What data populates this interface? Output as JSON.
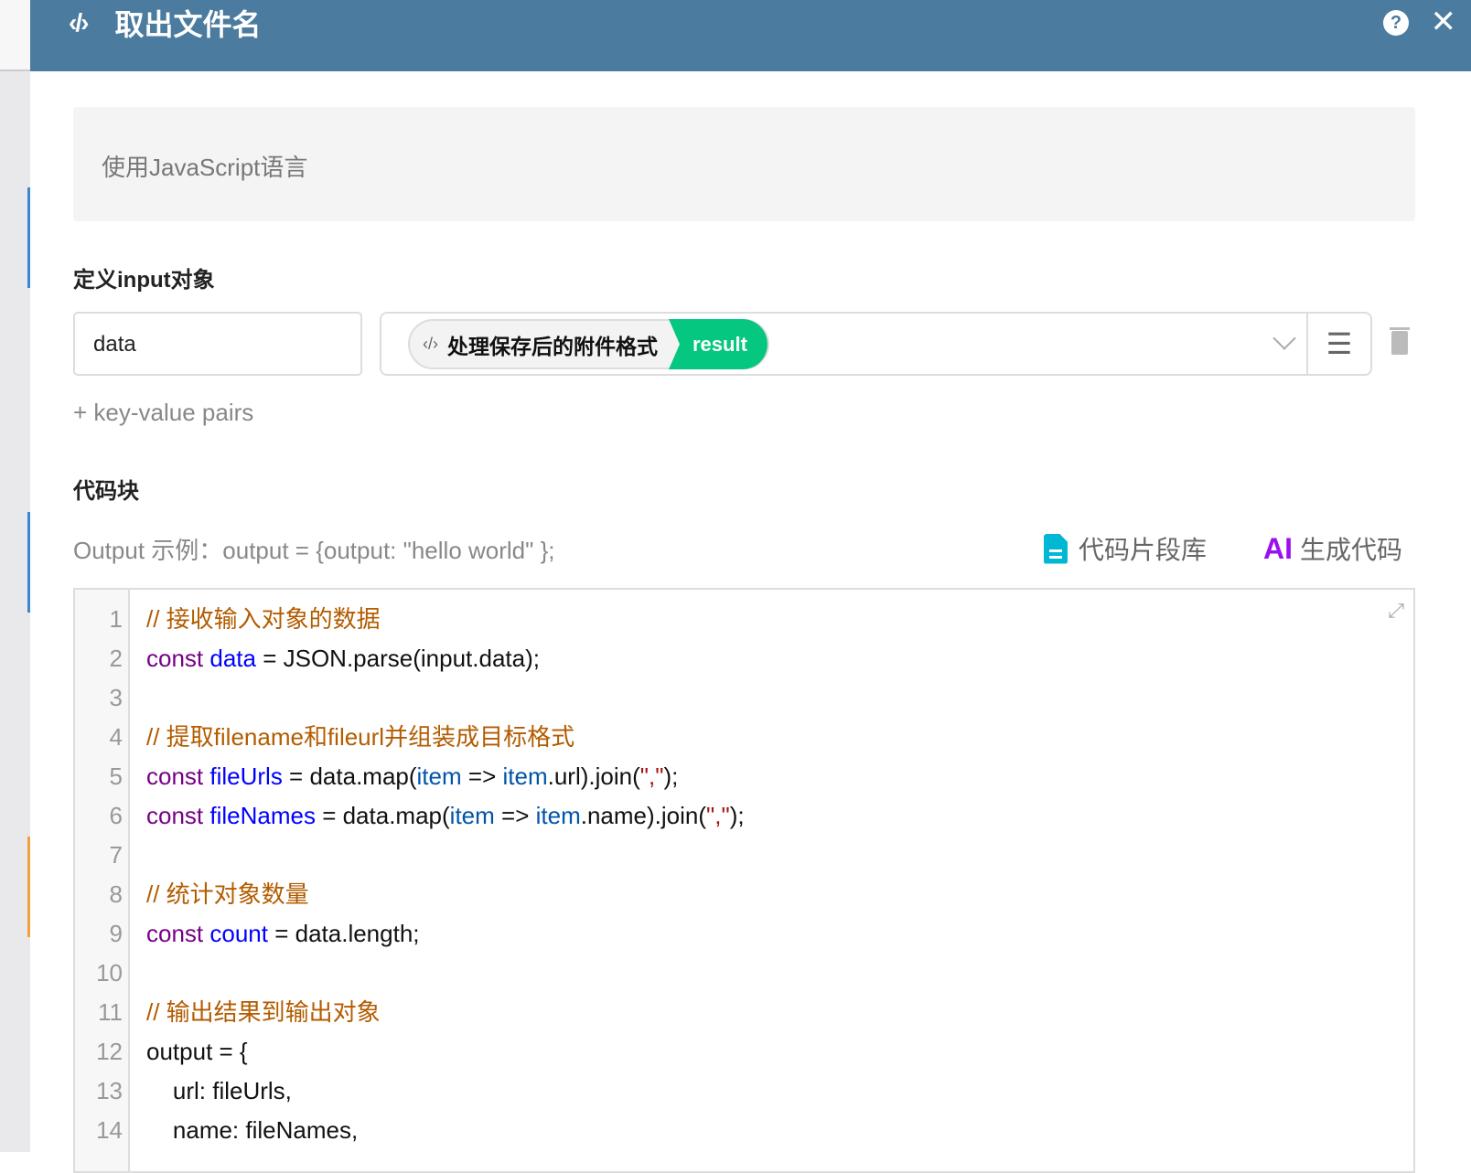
{
  "header": {
    "title": "取出文件名",
    "code_icon": "‹/›"
  },
  "description": "使用JavaScript语言",
  "input_section": {
    "label": "定义input对象",
    "key_value": "data",
    "source_node": "处理保存后的附件格式",
    "source_field": "result",
    "add_pair_link": "+ key-value pairs"
  },
  "code_section": {
    "label": "代码块",
    "output_example": "Output 示例：output = {output: \"hello world\" };",
    "snippet_library": "代码片段库",
    "ai_badge": "AI",
    "ai_generate": "生成代码"
  },
  "colors": {
    "header": "#4b7b9e",
    "result_tag": "#06c77f",
    "snippet_icon": "#00b8d4",
    "ai": "#9b10f0"
  },
  "code": {
    "lines": [
      {
        "n": "1",
        "tokens": [
          {
            "c": "c",
            "t": "// 接收输入对象的数据"
          }
        ]
      },
      {
        "n": "2",
        "tokens": [
          {
            "c": "k",
            "t": "const "
          },
          {
            "c": "v",
            "t": "data"
          },
          {
            "c": "p",
            "t": " = JSON.parse(input.data);"
          }
        ]
      },
      {
        "n": "3",
        "tokens": []
      },
      {
        "n": "4",
        "tokens": [
          {
            "c": "c",
            "t": "// 提取filename和fileurl并组装成目标格式"
          }
        ]
      },
      {
        "n": "5",
        "tokens": [
          {
            "c": "k",
            "t": "const "
          },
          {
            "c": "v",
            "t": "fileUrls"
          },
          {
            "c": "p",
            "t": " = data.map("
          },
          {
            "c": "d",
            "t": "item"
          },
          {
            "c": "p",
            "t": " => "
          },
          {
            "c": "d",
            "t": "item"
          },
          {
            "c": "p",
            "t": ".url).join("
          },
          {
            "c": "s",
            "t": "\",\""
          },
          {
            "c": "p",
            "t": ");"
          }
        ]
      },
      {
        "n": "6",
        "tokens": [
          {
            "c": "k",
            "t": "const "
          },
          {
            "c": "v",
            "t": "fileNames"
          },
          {
            "c": "p",
            "t": " = data.map("
          },
          {
            "c": "d",
            "t": "item"
          },
          {
            "c": "p",
            "t": " => "
          },
          {
            "c": "d",
            "t": "item"
          },
          {
            "c": "p",
            "t": ".name).join("
          },
          {
            "c": "s",
            "t": "\",\""
          },
          {
            "c": "p",
            "t": ");"
          }
        ]
      },
      {
        "n": "7",
        "tokens": []
      },
      {
        "n": "8",
        "tokens": [
          {
            "c": "c",
            "t": "// 统计对象数量"
          }
        ]
      },
      {
        "n": "9",
        "tokens": [
          {
            "c": "k",
            "t": "const "
          },
          {
            "c": "v",
            "t": "count"
          },
          {
            "c": "p",
            "t": " = data.length;"
          }
        ]
      },
      {
        "n": "10",
        "tokens": []
      },
      {
        "n": "11",
        "tokens": [
          {
            "c": "c",
            "t": "// 输出结果到输出对象"
          }
        ]
      },
      {
        "n": "12",
        "tokens": [
          {
            "c": "p",
            "t": "output = {"
          }
        ]
      },
      {
        "n": "13",
        "tokens": [
          {
            "c": "p",
            "t": "    url: fileUrls,"
          }
        ]
      },
      {
        "n": "14",
        "tokens": [
          {
            "c": "p",
            "t": "    name: fileNames,"
          }
        ]
      }
    ]
  }
}
